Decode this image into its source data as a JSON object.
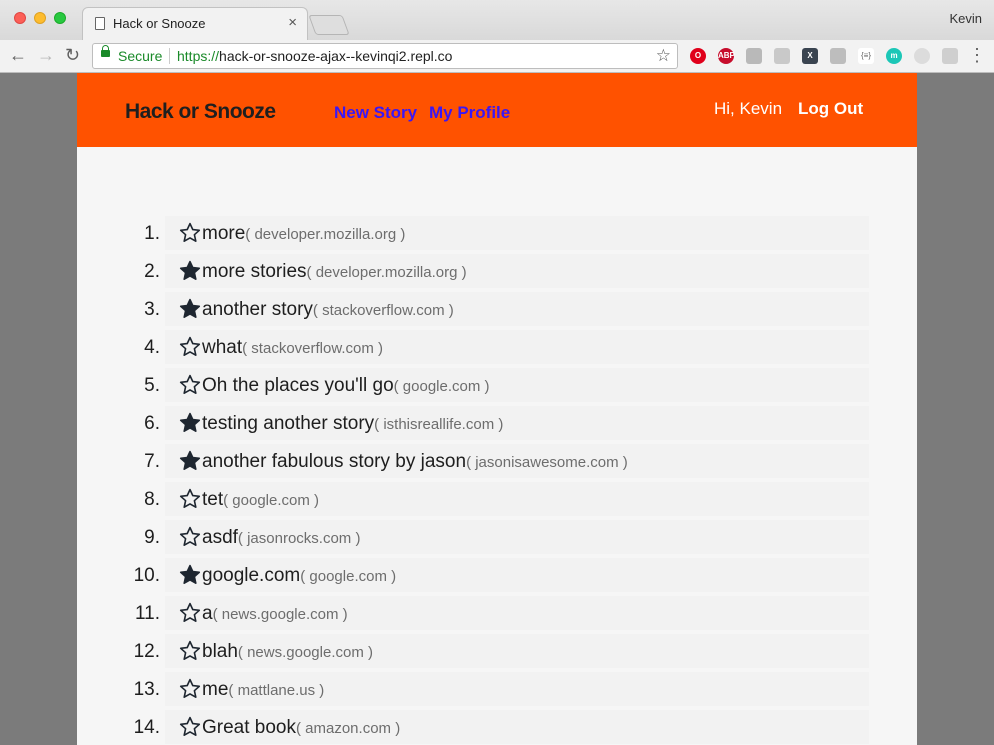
{
  "browser": {
    "tab_title": "Hack or Snooze",
    "tab_close": "×",
    "profile_name": "Kevin",
    "secure_label": "Secure",
    "url_scheme": "https://",
    "url_rest": "hack-or-snooze-ajax--kevinqi2.repl.co",
    "back": "←",
    "forward": "→",
    "reload": "↻",
    "bookmark": "☆",
    "menu": "⋮",
    "extensions": [
      {
        "name": "opera-icon",
        "text": "O",
        "color": "#e0001b"
      },
      {
        "name": "adblock-icon",
        "text": "ABP",
        "color": "#c70d2c"
      },
      {
        "name": "cube-icon",
        "text": "",
        "color": "#b9b9b9"
      },
      {
        "name": "flask-icon",
        "text": "",
        "color": "#c9c9c9"
      },
      {
        "name": "x-extension-icon",
        "text": "X",
        "color": "#3a4450"
      },
      {
        "name": "grid-extension-icon",
        "text": "",
        "color": "#bdbdbd"
      },
      {
        "name": "json-icon",
        "text": "{≡}",
        "color": "#ffffff"
      },
      {
        "name": "m-extension-icon",
        "text": "m",
        "color": "#1cc7b7"
      },
      {
        "name": "circle-extension-icon",
        "text": "",
        "color": "#dcdcdc"
      },
      {
        "name": "frame-extension-icon",
        "text": "",
        "color": "#cfcfcf"
      }
    ]
  },
  "nav": {
    "brand": "Hack or Snooze",
    "new_story": "New Story",
    "my_profile": "My Profile",
    "greeting": "Hi, Kevin",
    "logout": "Log Out",
    "colors": {
      "bar": "#ff5200",
      "link": "#3b17f5"
    }
  },
  "stories": [
    {
      "num": "1.",
      "title": "more",
      "host": "( developer.mozilla.org )",
      "favorite": false
    },
    {
      "num": "2.",
      "title": "more stories",
      "host": "( developer.mozilla.org )",
      "favorite": true
    },
    {
      "num": "3.",
      "title": "another story",
      "host": "( stackoverflow.com )",
      "favorite": true
    },
    {
      "num": "4.",
      "title": "what",
      "host": "( stackoverflow.com )",
      "favorite": false
    },
    {
      "num": "5.",
      "title": "Oh the places you'll go",
      "host": "( google.com )",
      "favorite": false
    },
    {
      "num": "6.",
      "title": "testing another story",
      "host": "( isthisreallife.com )",
      "favorite": true
    },
    {
      "num": "7.",
      "title": "another fabulous story by jason",
      "host": "( jasonisawesome.com )",
      "favorite": true
    },
    {
      "num": "8.",
      "title": "tet",
      "host": "( google.com )",
      "favorite": false
    },
    {
      "num": "9.",
      "title": "asdf",
      "host": "( jasonrocks.com )",
      "favorite": false
    },
    {
      "num": "10.",
      "title": "google.com",
      "host": "( google.com )",
      "favorite": true
    },
    {
      "num": "11.",
      "title": "a",
      "host": "( news.google.com )",
      "favorite": false
    },
    {
      "num": "12.",
      "title": "blah",
      "host": "( news.google.com )",
      "favorite": false
    },
    {
      "num": "13.",
      "title": "me",
      "host": "( mattlane.us )",
      "favorite": false
    },
    {
      "num": "14.",
      "title": "Great book",
      "host": "( amazon.com )",
      "favorite": false
    }
  ]
}
